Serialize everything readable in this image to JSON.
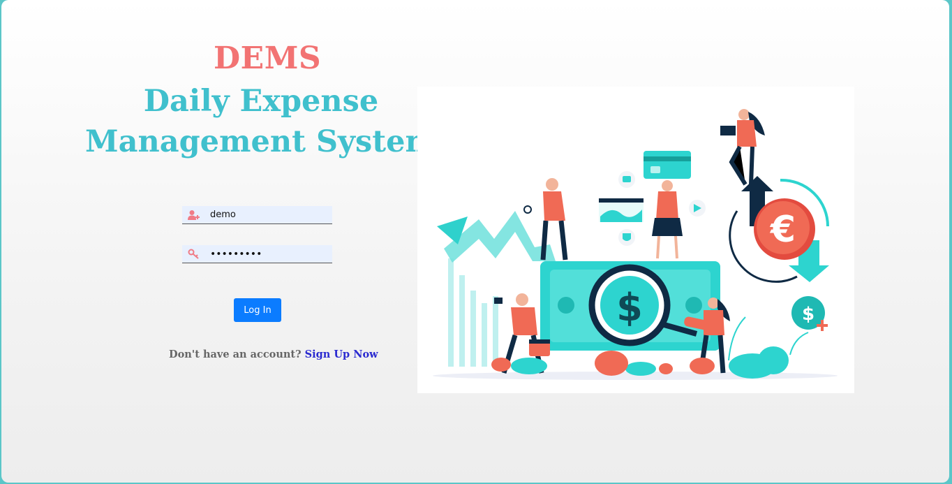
{
  "header": {
    "brand": "DEMS",
    "subtitle": "Daily Expense Management System"
  },
  "login_form": {
    "username": {
      "value": "demo",
      "icon": "user-plus-icon"
    },
    "password": {
      "value": "•••••••••",
      "icon": "key-icon"
    },
    "login_label": "Log In",
    "signup_prompt": "Don't have an account?",
    "signup_link": "Sign Up Now"
  },
  "illustration": {
    "icon": "finance-illustration",
    "currency_symbols": [
      "$",
      "€",
      "$"
    ]
  },
  "colors": {
    "brand": "#f27373",
    "subtitle": "#40c0cd",
    "button": "#0b7cff",
    "link": "#2a2ad0",
    "accent_teal": "#2dd4cf",
    "accent_coral": "#f06a55"
  }
}
